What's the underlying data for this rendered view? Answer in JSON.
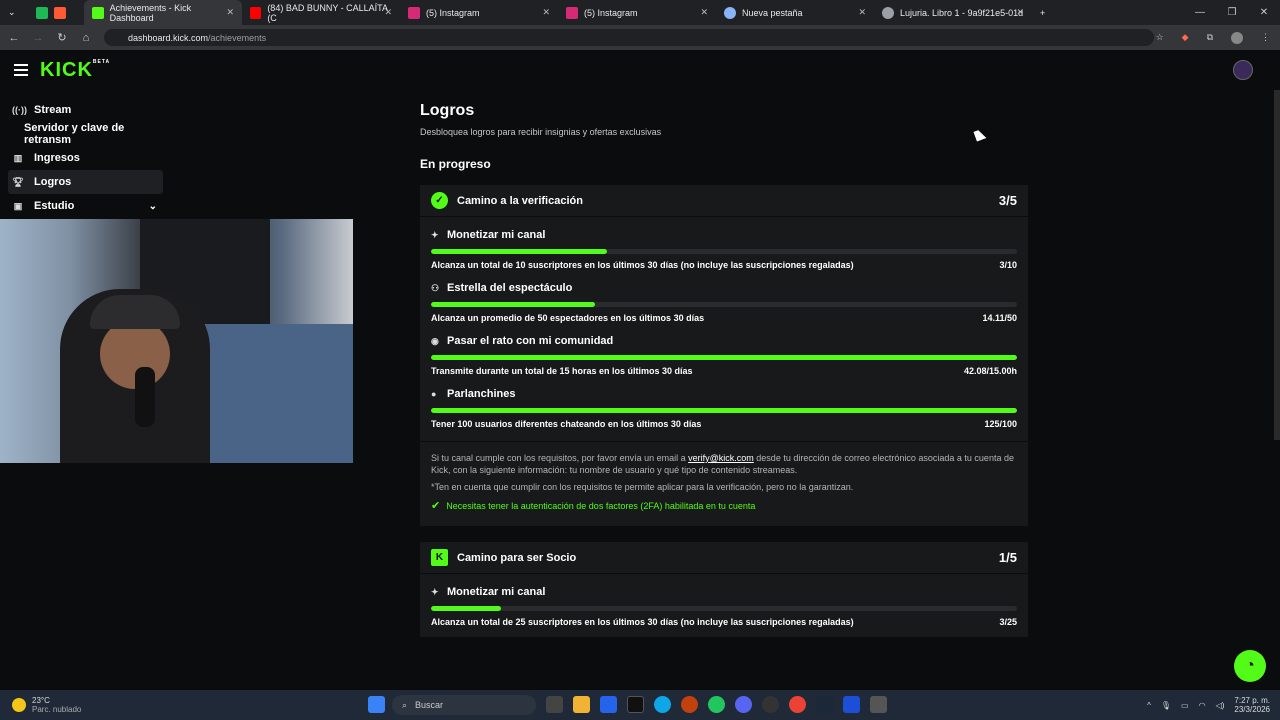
{
  "browser": {
    "tabs": [
      {
        "label": "Achievements - Kick Dashboard",
        "color": "#53fc18"
      },
      {
        "label": "(84) BAD BUNNY - CALLAÍTA (C",
        "color": "#ff0000"
      },
      {
        "label": "(5) Instagram",
        "color": "#d62976"
      },
      {
        "label": "(5) Instagram",
        "color": "#d62976"
      },
      {
        "label": "Nueva pestaña",
        "color": "#8ab4f8"
      },
      {
        "label": "Lujuria. Libro 1 - 9a9f21e5-01d",
        "color": "#9aa0a6"
      }
    ],
    "url_host": "dashboard.kick.com",
    "url_path": "/achievements"
  },
  "header": {
    "logo": "KICK",
    "logo_tag": "BETA"
  },
  "sidebar": {
    "items": [
      {
        "label": "Stream",
        "icon": "broadcast-icon"
      },
      {
        "label": "Servidor y clave de retransm",
        "icon": ""
      },
      {
        "label": "Ingresos",
        "icon": "chart-icon"
      },
      {
        "label": "Logros",
        "icon": "trophy-icon"
      },
      {
        "label": "Estudio",
        "icon": "studio-icon"
      }
    ]
  },
  "main": {
    "title": "Logros",
    "subtitle": "Desbloquea logros para recibir insignias y ofertas exclusivas",
    "section": "En progreso",
    "cards": [
      {
        "title": "Camino a la verificación",
        "count": "3/5",
        "achievements": [
          {
            "name": "Monetizar mi canal",
            "desc": "Alcanza un total de 10 suscriptores en los últimos 30 días (no incluye las suscripciones regaladas)",
            "value": "3/10",
            "progress": 0.3
          },
          {
            "name": "Estrella del espectáculo",
            "desc": "Alcanza un promedio de 50 espectadores en los últimos 30 días",
            "value": "14.11/50",
            "progress": 0.28
          },
          {
            "name": "Pasar el rato con mi comunidad",
            "desc": "Transmite durante un total de 15 horas en los últimos 30 días",
            "value": "42.08/15.00h",
            "progress": 1
          },
          {
            "name": "Parlanchines",
            "desc": "Tener 100 usuarios diferentes chateando en los últimos 30 días",
            "value": "125/100",
            "progress": 1
          }
        ],
        "info": {
          "text_before": "Si tu canal cumple con los requisitos, por favor envía un email a ",
          "email": "verify@kick.com",
          "text_after": " desde tu dirección de correo electrónico asociada a tu cuenta de Kick, con la siguiente información: tu nombre de usuario y qué tipo de contenido streameas.",
          "note": "*Ten en cuenta que cumplir con los requisitos te permite aplicar para la verificación, pero no la garantizan.",
          "check": "Necesitas tener la autenticación de dos factores (2FA) habilitada en tu cuenta"
        }
      },
      {
        "title": "Camino para ser Socio",
        "count": "1/5",
        "achievements": [
          {
            "name": "Monetizar mi canal",
            "desc": "Alcanza un total de 25 suscriptores en los últimos 30 días (no incluye las suscripciones regaladas)",
            "value": "3/25",
            "progress": 0.12
          }
        ]
      }
    ]
  },
  "taskbar": {
    "temp": "23°C",
    "weather": "Parc. nublado",
    "search": "Buscar",
    "time": "7:27 p. m.",
    "date": "23/3/2026"
  }
}
